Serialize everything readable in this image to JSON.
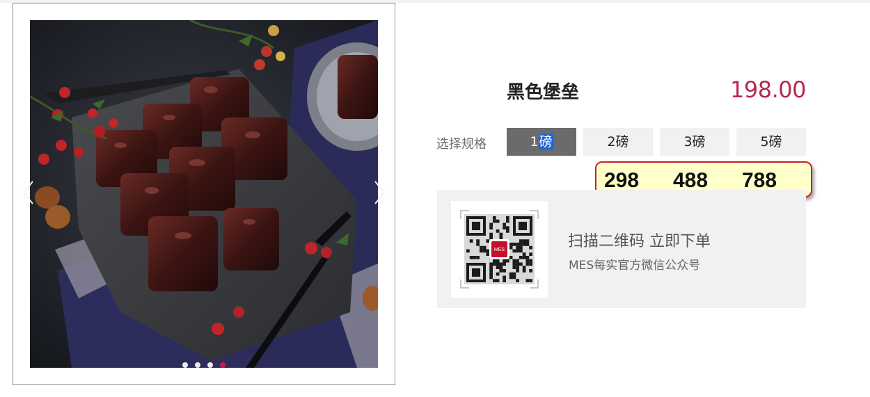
{
  "product": {
    "title": "黑色堡垒",
    "price": "198.00"
  },
  "spec": {
    "label": "选择规格",
    "options": [
      {
        "prefix": "1",
        "highlight": "磅",
        "selected": true
      },
      {
        "label": "2磅"
      },
      {
        "label": "3磅"
      },
      {
        "label": "5磅"
      }
    ]
  },
  "tooltip": {
    "prices": [
      "298",
      "488",
      "788"
    ]
  },
  "qr": {
    "title": "扫描二维码 立即下单",
    "subtitle": "MES每实官方微信公众号",
    "logo_text": "MES"
  },
  "gallery": {
    "slide_count": 4,
    "active_slide": 4,
    "prev_icon": "chevron-left-icon",
    "next_icon": "chevron-right-icon"
  },
  "colors": {
    "price": "#b8264f",
    "selected_spec_bg": "#6b6b6b",
    "dot_active": "#c41d4a",
    "tooltip_border": "#c8202a",
    "tooltip_bg": "#ffffca"
  }
}
